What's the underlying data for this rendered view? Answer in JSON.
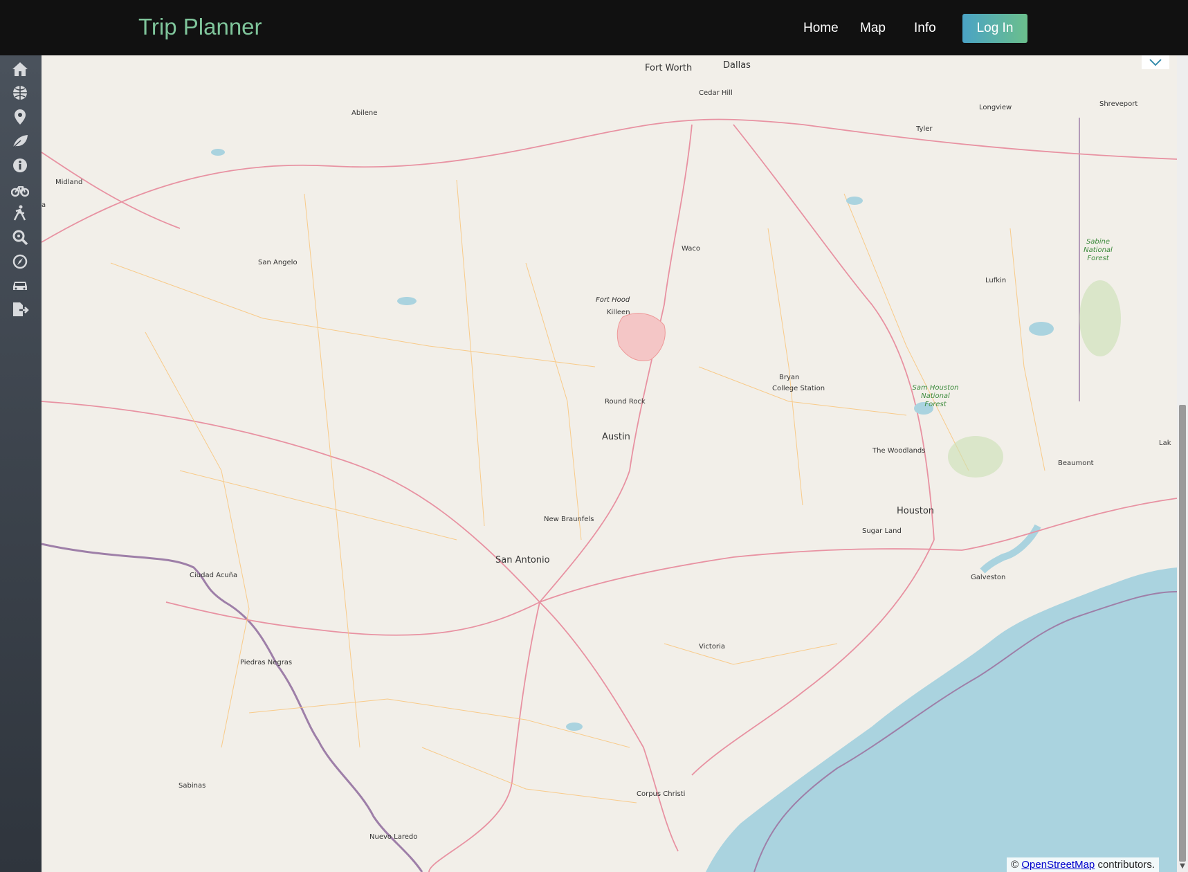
{
  "header": {
    "brand": "Trip Planner",
    "nav": [
      "Home",
      "Map",
      "Info"
    ],
    "login": "Log In"
  },
  "sidebar": {
    "icons": [
      "home-icon",
      "globe-icon",
      "map-marker-icon",
      "leaf-icon",
      "info-icon",
      "bicycle-icon",
      "hiking-icon",
      "search-location-icon",
      "compass-icon",
      "car-icon",
      "export-file-icon"
    ]
  },
  "map": {
    "cities": {
      "fort_worth": "Fort Worth",
      "dallas": "Dallas",
      "cedar_hill": "Cedar Hill",
      "abilene": "Abilene",
      "midland": "Midland",
      "shreveport": "Shreveport",
      "longview": "Longview",
      "tyler": "Tyler",
      "san_angelo": "San Angelo",
      "waco": "Waco",
      "fort_hood": "Fort Hood",
      "killeen": "Killeen",
      "lufkin": "Lufkin",
      "sabine_forest": [
        "Sabine",
        "National",
        "Forest"
      ],
      "bryan": "Bryan",
      "college_station": "College Station",
      "sam_houston_forest": [
        "Sam Houston",
        "National",
        "Forest"
      ],
      "round_rock": "Round Rock",
      "austin": "Austin",
      "the_woodlands": "The Woodlands",
      "beaumont": "Beaumont",
      "houston": "Houston",
      "sugar_land": "Sugar Land",
      "galveston": "Galveston",
      "new_braunfels": "New Braunfels",
      "san_antonio": "San Antonio",
      "ciudad_acuna": "Ciudad Acuña",
      "piedras_negras": "Piedras Negras",
      "victoria": "Victoria",
      "sabinas": "Sabinas",
      "corpus_christi": "Corpus Christi",
      "nuevo_laredo": "Nuevo Laredo",
      "edge_a": "a",
      "edge_lak": "Lak"
    },
    "attribution": {
      "prefix": "©",
      "link": "OpenStreetMap",
      "suffix": " contributors."
    }
  },
  "colors": {
    "topbar": "#111111",
    "brand": "#7fc59b",
    "land": "#f2efe9",
    "water": "#aad3df",
    "highway": "#e892a2",
    "road": "#f9c77f",
    "border": "#9e7fa8"
  }
}
